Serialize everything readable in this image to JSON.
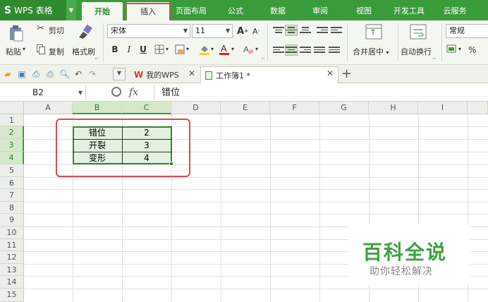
{
  "app": {
    "logo": "S",
    "name": "WPS 表格"
  },
  "menu_tabs": [
    "开始",
    "插入",
    "页面布局",
    "公式",
    "数据",
    "审阅",
    "视图",
    "开发工具",
    "云服务"
  ],
  "ribbon": {
    "paste_label": "粘贴",
    "cut_label": "剪切",
    "copy_label": "复制",
    "format_painter_label": "格式刷",
    "font_name": "宋体",
    "font_size": "11",
    "bold": "B",
    "italic": "I",
    "underline": "U",
    "merge_center_label": "合并居中",
    "wrap_text_label": "自动换行",
    "number_format": "常规",
    "percent": "%",
    "grow_font": "A",
    "shrink_font": "A"
  },
  "doc_tabs": [
    {
      "label": "我的WPS"
    },
    {
      "label": "工作簿1 *"
    }
  ],
  "formula_bar": {
    "name_box": "B2",
    "fx": "fx",
    "content": "错位"
  },
  "columns": [
    "A",
    "B",
    "C",
    "D",
    "E",
    "F",
    "G",
    "H",
    "I"
  ],
  "rows": [
    "1",
    "2",
    "3",
    "4",
    "5",
    "6",
    "7",
    "8",
    "9",
    "10",
    "11",
    "12",
    "13",
    "14",
    "15"
  ],
  "cells": [
    {
      "b": "错位",
      "c": "2"
    },
    {
      "b": "开裂",
      "c": "3"
    },
    {
      "b": "变形",
      "c": "4"
    }
  ],
  "watermark": {
    "title": "百科全说",
    "subtitle": "助你轻松解决"
  },
  "colors": {
    "brand_green": "#3a9b3a",
    "highlight_red": "#e0484d"
  }
}
